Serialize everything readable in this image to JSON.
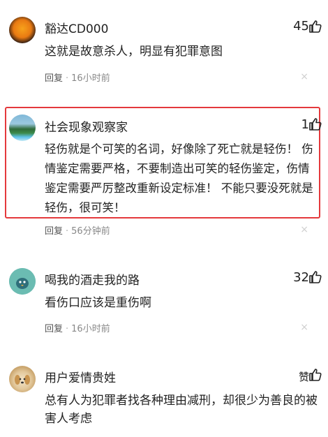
{
  "comments": [
    {
      "username": "豁达CD000",
      "likes": "45",
      "text": "这就是故意杀人，明显有犯罪意图",
      "reply": "回复",
      "time": "16小时前",
      "close": "×"
    },
    {
      "username": "社会现象观察家",
      "likes": "1",
      "text": "轻伤就是个可笑的名词，好像除了死亡就是轻伤！ 伤情鉴定需要严格，不要制造出可笑的轻伤鉴定，伤情鉴定需要严厉整改重新设定标准！ 不能只要没死就是轻伤，很可笑！",
      "reply": "回复",
      "time": "56分钟前",
      "close": "×"
    },
    {
      "username": "喝我的酒走我的路",
      "likes": "32",
      "text": "看伤口应该是重伤啊",
      "reply": "回复",
      "time": "16小时前",
      "close": "×"
    },
    {
      "username": "用户爱情贵姓",
      "likes": "赞",
      "text": "总有人为犯罪者找各种理由减刑，却很少为善良的被害人考虑"
    }
  ]
}
